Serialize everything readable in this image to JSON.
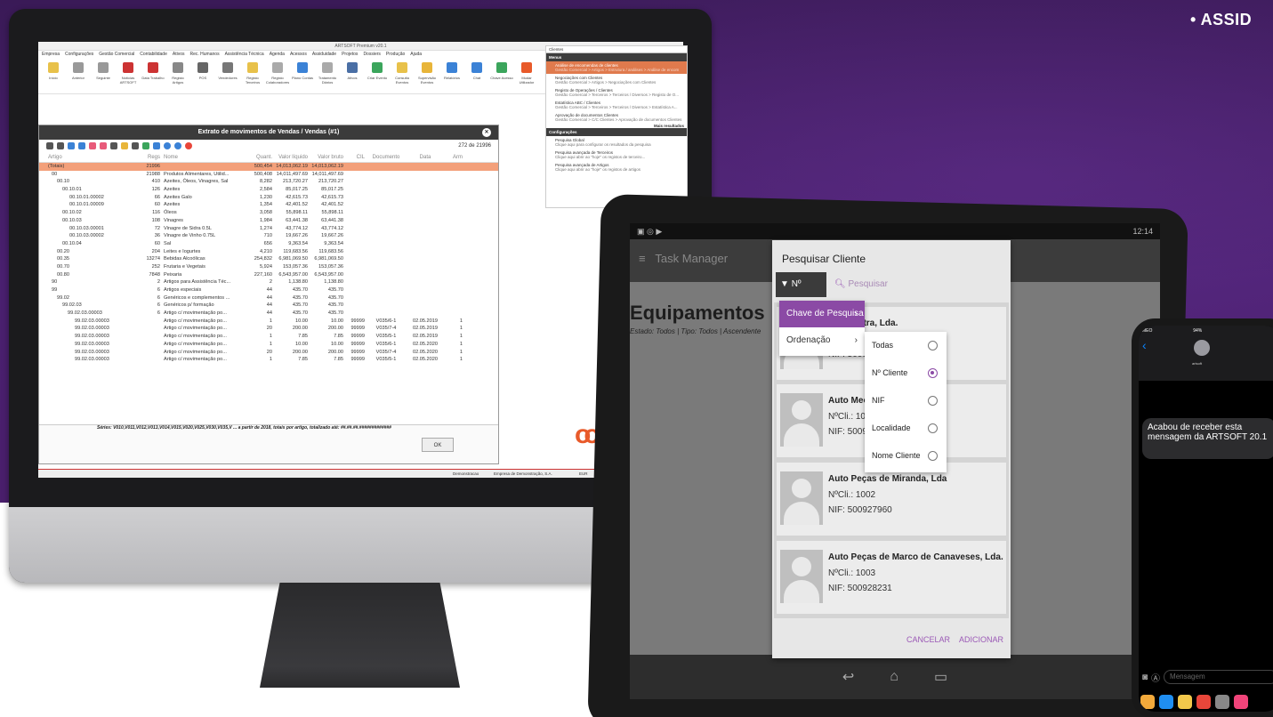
{
  "banner": {
    "bullet": "• ASSID"
  },
  "desktop": {
    "window_title": "ARTSOFT Premium v20.1",
    "menu": [
      "Empresa",
      "Configurações",
      "Gestão Comercial",
      "Contabilidade",
      "Ativos",
      "Rec. Humanos",
      "Assistência Técnica",
      "Agenda",
      "Acessos",
      "Assiduidade",
      "Projetos",
      "Dossiers",
      "Produção",
      "Ajuda"
    ],
    "ribbon": [
      "Início",
      "Anterior",
      "Seguinte",
      "Notícias ARTSOFT",
      "Data Trabalho",
      "Registo Artigos",
      "POS",
      "Vendedores",
      "Registo Terceiros",
      "Registo Colaboradores",
      "Plano Contas",
      "Tratamento Diários",
      "Ativos",
      "Criar Evento",
      "Consulta Eventos",
      "Supervisão Eventos",
      "Relatórios",
      "Chat",
      "Chave Acesso",
      "Mudar Utilizador",
      "Sair"
    ],
    "dialog": {
      "title": "Extrato de movimentos de Vendas / Vendas (#1)",
      "count": "272 de 21996",
      "headers": [
        "Artigo",
        "Regs",
        "Nome",
        "Quant.",
        "Valor líquido",
        "Valor bruto",
        "CIL",
        "Documento",
        "Data",
        "Arm"
      ],
      "rows": [
        [
          "(Totais)",
          "21996",
          "",
          "500,454",
          "14,013,062.19",
          "14,013,062.19",
          "",
          "",
          "",
          ""
        ],
        [
          "00",
          "21988",
          "Produtos Alimentares, Utilid...",
          "500,408",
          "14,011,497.69",
          "14,011,497.69",
          "",
          "",
          "",
          ""
        ],
        [
          "00.10",
          "410",
          "Azeites, Óleos, Vinagres, Sal",
          "8,282",
          "213,720.27",
          "213,720.27",
          "",
          "",
          "",
          ""
        ],
        [
          "00.10.01",
          "126",
          "Azeites",
          "2,584",
          "85,017.25",
          "85,017.25",
          "",
          "",
          "",
          ""
        ],
        [
          "00.10.01.00002",
          "66",
          "Azeites Galo",
          "1,230",
          "42,615.73",
          "42,615.73",
          "",
          "",
          "",
          ""
        ],
        [
          "00.10.01.00009",
          "60",
          "Azeites",
          "1,354",
          "42,401.52",
          "42,401.52",
          "",
          "",
          "",
          ""
        ],
        [
          "00.10.02",
          "116",
          "Óleos",
          "3,058",
          "55,898.11",
          "55,898.11",
          "",
          "",
          "",
          ""
        ],
        [
          "00.10.03",
          "108",
          "Vinagres",
          "1,984",
          "63,441.38",
          "63,441.38",
          "",
          "",
          "",
          ""
        ],
        [
          "00.10.03.00001",
          "72",
          "Vinagre de Sidra 0.5L",
          "1,274",
          "43,774.12",
          "43,774.12",
          "",
          "",
          "",
          ""
        ],
        [
          "00.10.03.00002",
          "36",
          "Vinagre de Vinho 0.75L",
          "710",
          "19,667.26",
          "19,667.26",
          "",
          "",
          "",
          ""
        ],
        [
          "00.10.04",
          "60",
          "Sal",
          "656",
          "9,363.54",
          "9,363.54",
          "",
          "",
          "",
          ""
        ],
        [
          "00.20",
          "204",
          "Leites e Iogurtes",
          "4,210",
          "119,683.56",
          "119,683.56",
          "",
          "",
          "",
          ""
        ],
        [
          "00.35",
          "13274",
          "Bebidas Alcoólicas",
          "254,832",
          "6,981,069.50",
          "6,981,069.50",
          "",
          "",
          "",
          ""
        ],
        [
          "00.70",
          "252",
          "Frutaria e Vegetais",
          "5,924",
          "153,057.36",
          "153,057.36",
          "",
          "",
          "",
          ""
        ],
        [
          "00.80",
          "7848",
          "Peixaria",
          "227,160",
          "6,543,957.00",
          "6,543,957.00",
          "",
          "",
          "",
          ""
        ],
        [
          "90",
          "2",
          "Artigos para Assistência Téc...",
          "2",
          "1,138.80",
          "1,138.80",
          "",
          "",
          "",
          ""
        ],
        [
          "99",
          "6",
          "Artigos especiais",
          "44",
          "435.70",
          "435.70",
          "",
          "",
          "",
          ""
        ],
        [
          "99.02",
          "6",
          "Genéricos e complementos ...",
          "44",
          "435.70",
          "435.70",
          "",
          "",
          "",
          ""
        ],
        [
          "99.02.03",
          "6",
          "Genéricos p/ formação",
          "44",
          "435.70",
          "435.70",
          "",
          "",
          "",
          ""
        ],
        [
          "99.02.03.00003",
          "6",
          "Artigo c/ movimentação po...",
          "44",
          "435.70",
          "435.70",
          "",
          "",
          "",
          ""
        ],
        [
          "99.02.03.00003",
          "",
          "Artigo c/ movimentação po...",
          "1",
          "10.00",
          "10.00",
          "99999",
          "V035/6-1",
          "02.05.2019",
          "1"
        ],
        [
          "99.02.03.00003",
          "",
          "Artigo c/ movimentação po...",
          "20",
          "200.00",
          "200.00",
          "99999",
          "V035/7-4",
          "02.05.2019",
          "1"
        ],
        [
          "99.02.03.00003",
          "",
          "Artigo c/ movimentação po...",
          "1",
          "7.85",
          "7.85",
          "99999",
          "V035/5-1",
          "02.05.2019",
          "1"
        ],
        [
          "99.02.03.00003",
          "",
          "Artigo c/ movimentação po...",
          "1",
          "10.00",
          "10.00",
          "99999",
          "V035/6-1",
          "02.05.2020",
          "1"
        ],
        [
          "99.02.03.00003",
          "",
          "Artigo c/ movimentação po...",
          "20",
          "200.00",
          "200.00",
          "99999",
          "V035/7-4",
          "02.05.2020",
          "1"
        ],
        [
          "99.02.03.00003",
          "",
          "Artigo c/ movimentação po...",
          "1",
          "7.85",
          "7.85",
          "99999",
          "V035/5-1",
          "02.05.2020",
          "1"
        ]
      ],
      "footer_note": "Séries: V010,V011,V012,V013,V014,V015,V020,V025,V030,V035,V ... a partir de 2018, totais por artigo, totalizado até: ##.##.##.#############",
      "ok_label": "OK"
    },
    "statusbar": {
      "left": "Demonstracao",
      "company": "Empresa de Demonstração, S.A.",
      "currency": "EUR"
    },
    "side_panel": {
      "search": "Clientes",
      "menus_title": "Menus",
      "items": [
        {
          "title": "Análise de encomendas de clientes",
          "path": "Gestão Comercial > Artigos > Estrutura / análises > Análise de encom"
        },
        {
          "title": "Negociações com Clientes",
          "path": "Gestão Comercial > Artigos > Negociações com Clientes"
        },
        {
          "title": "Registo de Operações / Clientes",
          "path": "Gestão Comercial > Terceiros > Terceiros / Diversos > Registo de O..."
        },
        {
          "title": "Estatística ABC / Clientes",
          "path": "Gestão Comercial > Terceiros > Terceiros / Diversos > Estatística A..."
        },
        {
          "title": "Aprovação de documentos Clientes",
          "path": "Gestão Comercial > C/C Clientes > Aprovação de documentos Clientes"
        }
      ],
      "more": "Mais resultados",
      "config_title": "Configurações",
      "config_items": [
        {
          "title": "Pesquisa Global",
          "path": "Clique aqui para configurar os resultados da pesquisa"
        },
        {
          "title": "Pesquisa avançada de Terceiros",
          "path": "Clique aqui abrir ao \"hoje\" os registos de terceiro..."
        },
        {
          "title": "Pesquisa avançada de Artigos",
          "path": "Clique aqui abrir ao \"hoje\" os registos de artigos"
        }
      ]
    }
  },
  "tablet": {
    "time": "12:14",
    "app_title": "Task Manager",
    "page_title": "Equipamentos",
    "page_sub": "Estado: Todos | Tipo: Todos | Ascendente",
    "dialog_title": "Pesquisar Cliente",
    "filter_label": "Nº Cliente",
    "search_placeholder": "Pesquisar",
    "menu": [
      {
        "label": "Chave de Pesquisa"
      },
      {
        "label": "Ordenação"
      }
    ],
    "options": [
      {
        "label": "Todas",
        "selected": false
      },
      {
        "label": "Nº Cliente",
        "selected": true
      },
      {
        "label": "NIF",
        "selected": false
      },
      {
        "label": "Localidade",
        "selected": false
      },
      {
        "label": "Nome Cliente",
        "selected": false
      }
    ],
    "cards": [
      {
        "name": "Mira-Sintra, Lda.",
        "line1": "0",
        "line2": "NIF: 5009"
      },
      {
        "name": "Auto Mecân",
        "line1": "NºCli.: 1001",
        "line2": "NIF: 50092"
      },
      {
        "name": "Auto Peças de Miranda, Lda",
        "line1": "NºCli.: 1002",
        "line2": "NIF: 500927960"
      },
      {
        "name": "Auto Peças de Marco de Canaveses, Lda.",
        "line1": "NºCli.: 1003",
        "line2": "NIF: 500928231"
      }
    ],
    "cancel": "CANCELAR",
    "add": "ADICIONAR"
  },
  "phone": {
    "carrier": "MEO",
    "battery": "94%",
    "contact": "artsoft",
    "message": "Acabou de receber esta mensagem da ARTSOFT 20.1",
    "input_placeholder": "Mensagem"
  }
}
